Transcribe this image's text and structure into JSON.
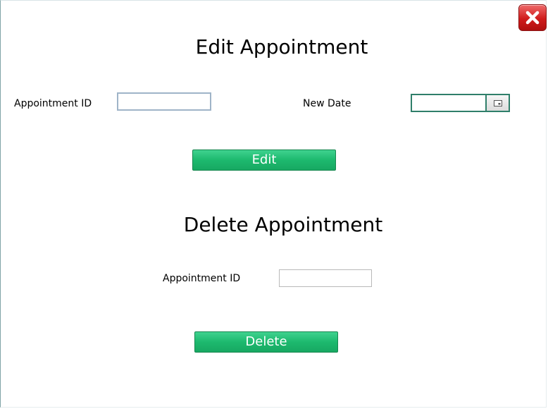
{
  "close": {
    "icon": "close-x-icon"
  },
  "edit": {
    "title": "Edit Appointment",
    "appointment_id_label": "Appointment ID",
    "appointment_id_value": "",
    "new_date_label": "New Date",
    "new_date_value": "",
    "date_picker_icon": "calendar-icon",
    "button_label": "Edit"
  },
  "delete": {
    "title": "Delete Appointment",
    "appointment_id_label": "Appointment ID",
    "appointment_id_value": "",
    "button_label": "Delete"
  },
  "colors": {
    "button_green": "#1db96e",
    "close_red": "#d01c1c",
    "date_border": "#2f7f6a"
  }
}
